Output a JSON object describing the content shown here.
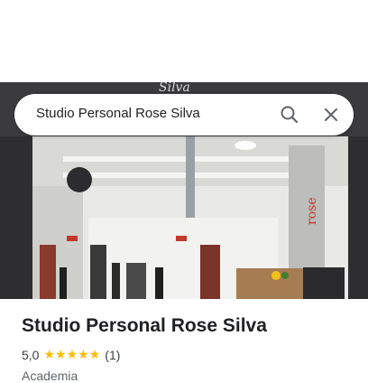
{
  "search": {
    "query": "Studio Personal Rose Silva",
    "search_icon": "search-icon",
    "close_icon": "close-icon"
  },
  "photo": {
    "storefront_sign": "Silva",
    "wall_logo": "rose"
  },
  "place": {
    "name": "Studio Personal Rose Silva",
    "rating": "5,0",
    "stars": 5,
    "star_icon": "star-icon",
    "star_color": "#fbbc04",
    "review_count": "(1)",
    "category": "Academia"
  }
}
